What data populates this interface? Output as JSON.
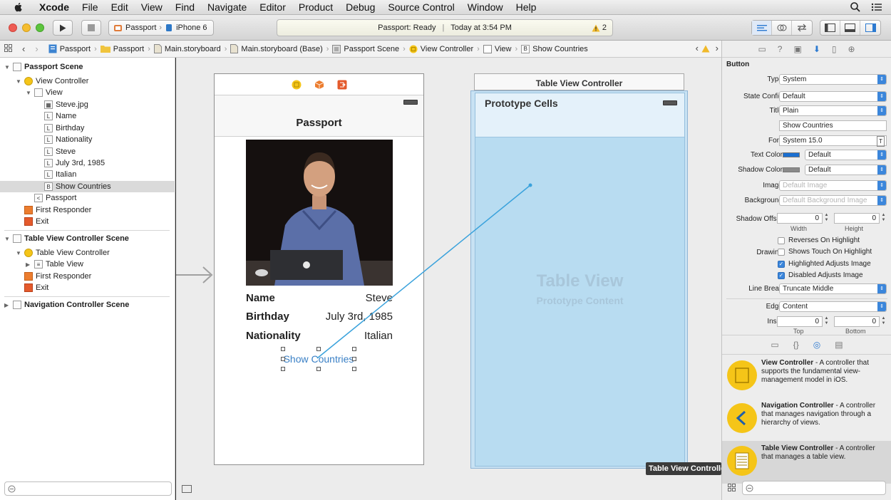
{
  "menubar": {
    "app": "Xcode",
    "items": [
      "File",
      "Edit",
      "View",
      "Find",
      "Navigate",
      "Editor",
      "Product",
      "Debug",
      "Source Control",
      "Window",
      "Help"
    ]
  },
  "toolbar": {
    "scheme": "Passport",
    "device": "iPhone 6",
    "activity_status": "Passport: Ready",
    "activity_time": "Today at 3:54 PM",
    "warning_count": "2"
  },
  "jumpbar": {
    "crumbs": [
      "Passport",
      "Passport",
      "Main.storyboard",
      "Main.storyboard (Base)",
      "Passport Scene",
      "View Controller",
      "View",
      "Show Countries"
    ]
  },
  "navigator": {
    "passport_scene": "Passport Scene",
    "view_controller": "View Controller",
    "view": "View",
    "children": [
      "Steve.jpg",
      "Name",
      "Birthday",
      "Nationality",
      "Steve",
      "July 3rd, 1985",
      "Italian",
      "Show Countries"
    ],
    "passport_item": "Passport",
    "first_responder": "First Responder",
    "exit": "Exit",
    "tvc_scene": "Table View Controller Scene",
    "tvc": "Table View Controller",
    "table_view": "Table View",
    "first_responder_2": "First Responder",
    "exit_2": "Exit",
    "nav_scene": "Navigation Controller Scene"
  },
  "canvas": {
    "passport_title": "Passport",
    "name_label": "Name",
    "name_value": "Steve",
    "birthday_label": "Birthday",
    "birthday_value": "July 3rd, 1985",
    "nationality_label": "Nationality",
    "nationality_value": "Italian",
    "button_title": "Show Countries",
    "tvc_title": "Table View Controller",
    "prototype_cells": "Prototype Cells",
    "table_view": "Table View",
    "prototype_content": "Prototype Content",
    "tooltip": "Table View Controlle"
  },
  "inspector": {
    "section": "Button",
    "type_label": "Type",
    "type_value": "System",
    "state_label": "State Config",
    "state_value": "Default",
    "title_label": "Title",
    "title_value": "Plain",
    "title_text": "Show Countries",
    "font_label": "Font",
    "font_value": "System 15.0",
    "text_color_label": "Text Color",
    "text_color_value": "Default",
    "shadow_color_label": "Shadow Color",
    "shadow_color_value": "Default",
    "image_label": "Image",
    "image_placeholder": "Default Image",
    "background_label": "Background",
    "background_placeholder": "Default Background Image",
    "shadow_offset_label": "Shadow Offset",
    "shadow_w": "0",
    "shadow_h": "0",
    "width_label": "Width",
    "height_label": "Height",
    "drawing_label": "Drawing",
    "cb_reverses": "Reverses On Highlight",
    "cb_shows_touch": "Shows Touch On Highlight",
    "cb_highlighted": "Highlighted Adjusts Image",
    "cb_disabled": "Disabled Adjusts Image",
    "line_break_label": "Line Break",
    "line_break_value": "Truncate Middle",
    "edge_label": "Edge",
    "edge_value": "Content",
    "inset_label": "Inset",
    "inset_top": "0",
    "inset_bottom": "0",
    "top_label": "Top",
    "bottom_label": "Bottom",
    "checkbox_states": {
      "reverses": false,
      "shows_touch": false,
      "highlighted": true,
      "disabled": true
    }
  },
  "library": [
    {
      "title": "View Controller",
      "desc": " - A controller that supports the fundamental view-management model in iOS."
    },
    {
      "title": "Navigation Controller",
      "desc": " - A controller that manages navigation through a hierarchy of views."
    },
    {
      "title": "Table View Controller",
      "desc": " - A controller that manages a table view."
    }
  ],
  "colors": {
    "accent": "#3b86db",
    "text_color_swatch": "#1a6fd1",
    "shadow_color_swatch": "#8a8a8a",
    "connection": "#3aa2dc"
  }
}
